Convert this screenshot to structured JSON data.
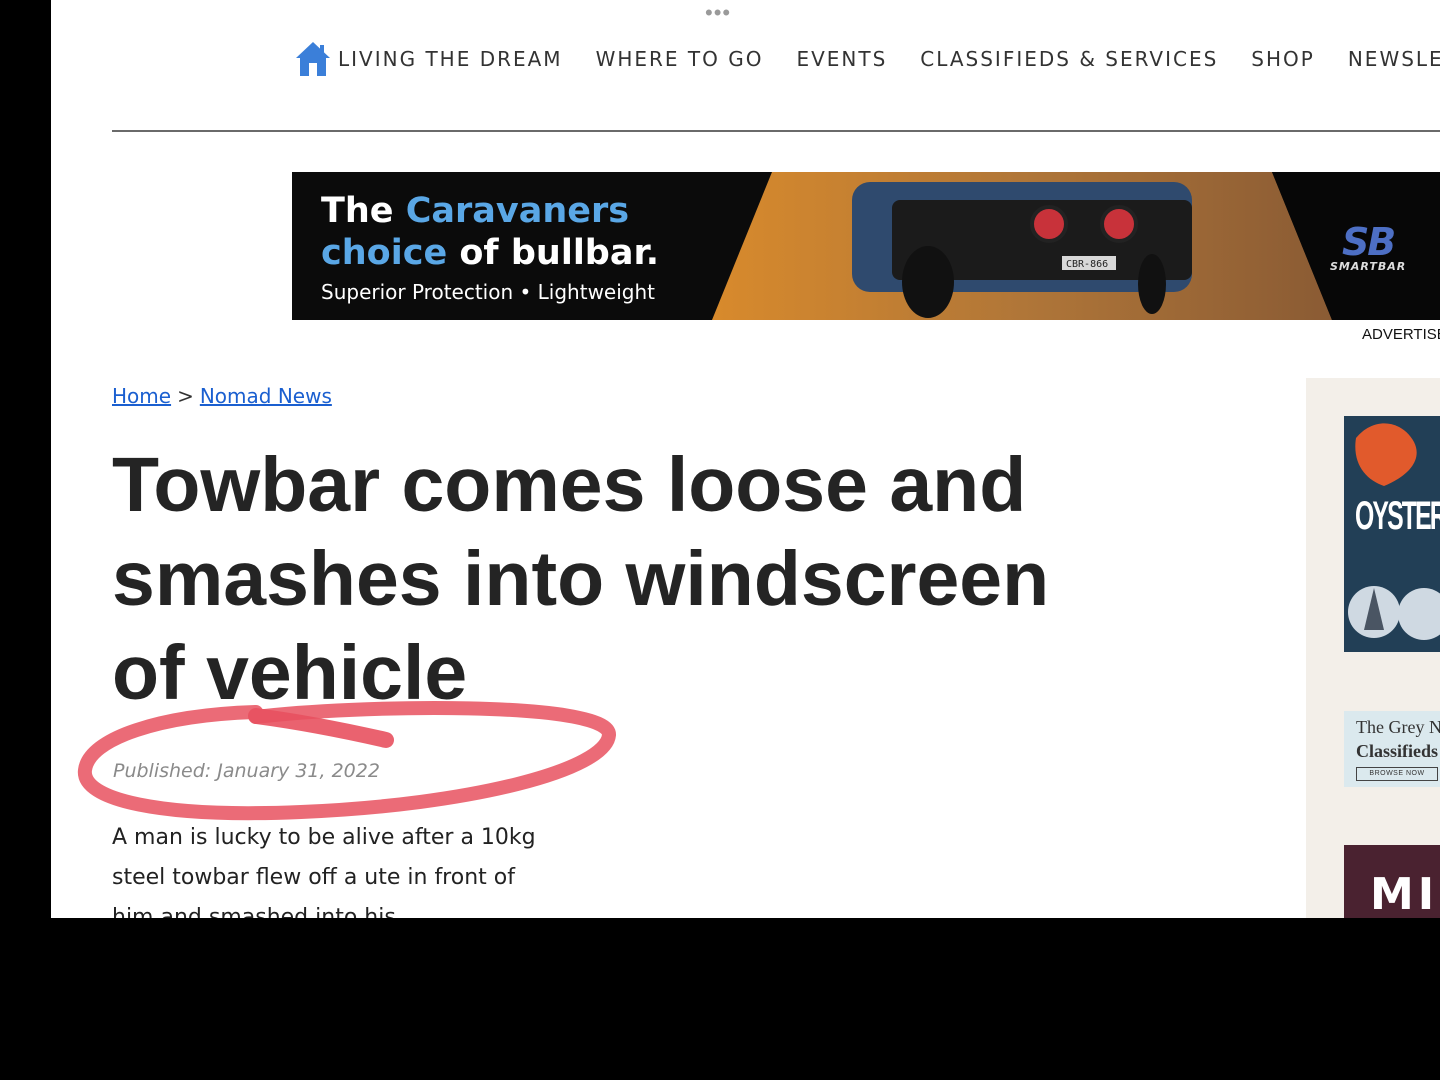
{
  "nav": {
    "items": [
      "LIVING THE DREAM",
      "WHERE TO GO",
      "EVENTS",
      "CLASSIFIEDS & SERVICES",
      "SHOP",
      "NEWSLET"
    ]
  },
  "ad_banner": {
    "line1_a": "The ",
    "line1_b": "Caravaners",
    "line2_a": "choice",
    "line2_b": " of bullbar.",
    "line3": "Superior Protection • Lightweight",
    "plate": "CBR-866",
    "brand_mark": "SB",
    "brand_word": "SMARTBAR",
    "label": "ADVERTISE",
    "accent_color": "#5aa7e6"
  },
  "breadcrumb": {
    "home": "Home",
    "separator": ">",
    "section": "Nomad News"
  },
  "article": {
    "title": "Towbar comes loose and smashes into windscreen of vehicle",
    "published": "Published: January 31, 2022",
    "body": "A man is lucky to be alive after a 10kg steel towbar flew off a ute in front of him and smashed into his"
  },
  "sidebar": {
    "ad1_text": "OYSTER",
    "ad2_line1": "The Grey N",
    "ad2_line2": "Classifieds",
    "ad2_button": "BROWSE NOW",
    "ad3_text": "MI"
  },
  "colors": {
    "link": "#1a5fd0",
    "annotation": "#e8515f",
    "home_icon": "#3b7fd9"
  }
}
